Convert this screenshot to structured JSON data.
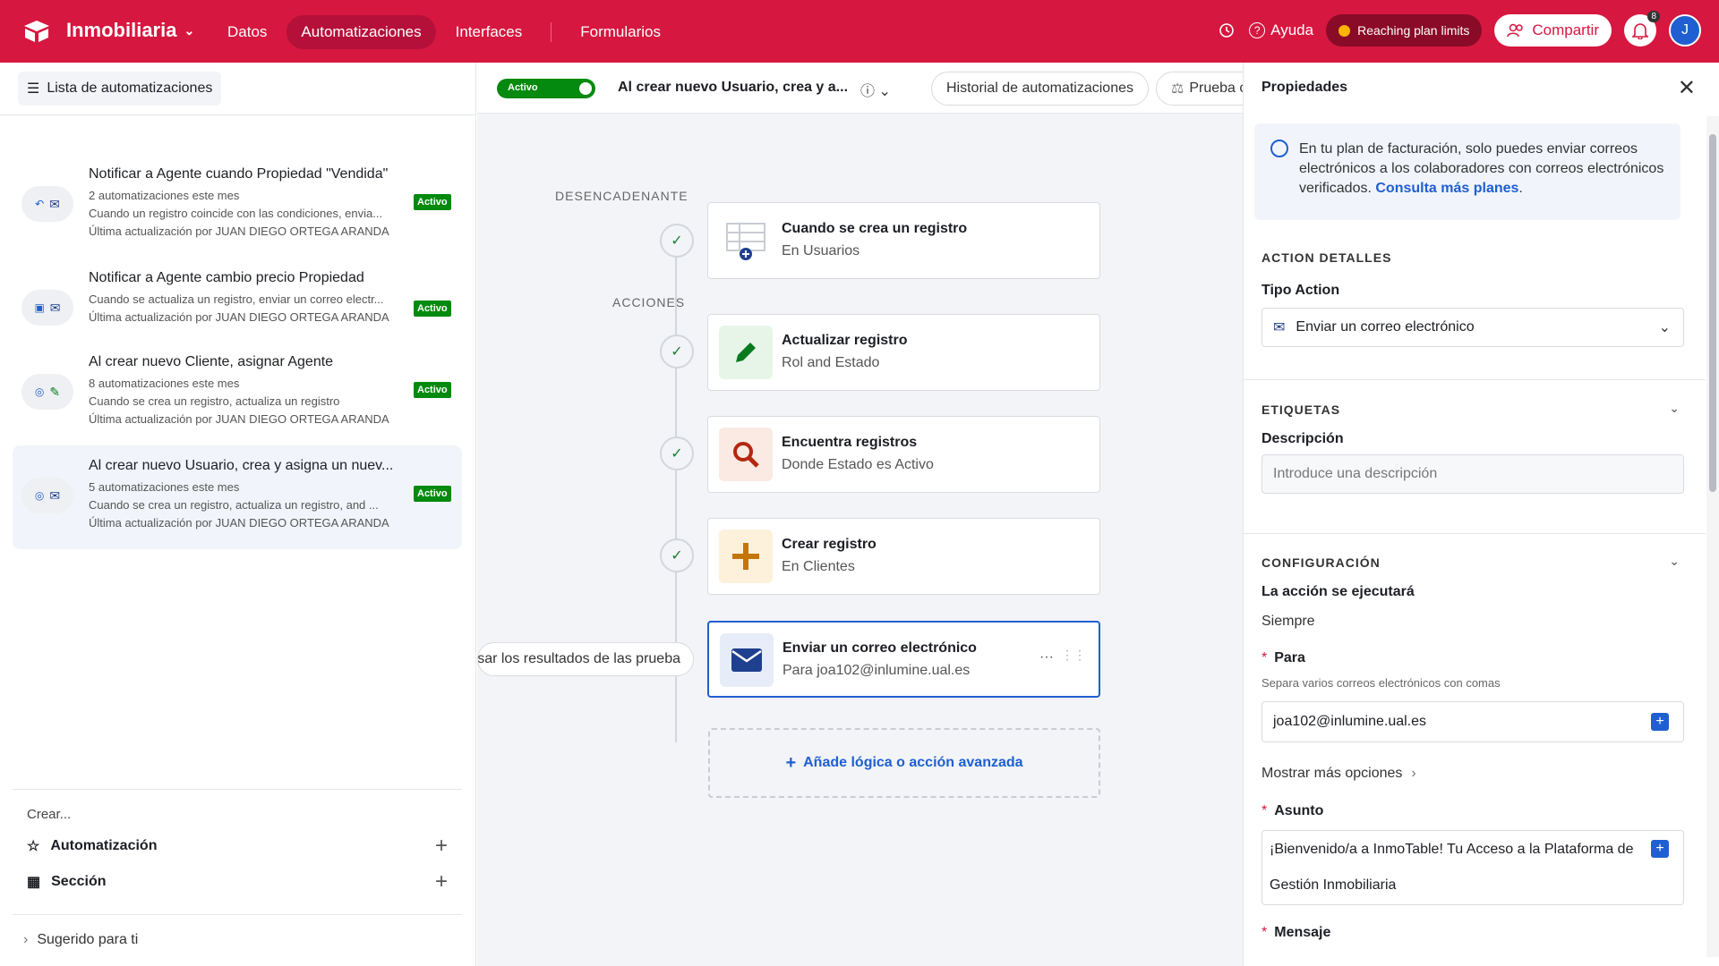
{
  "topbar": {
    "app_name": "Inmobiliaria",
    "tabs": [
      {
        "label": "Datos"
      },
      {
        "label": "Automatizaciones"
      },
      {
        "label": "Interfaces"
      },
      {
        "label": "Formularios"
      }
    ],
    "help_label": "Ayuda",
    "plan_label": "Reaching plan limits",
    "share_label": "Compartir",
    "notification_count": "8",
    "avatar_initial": "J"
  },
  "left": {
    "list_button": "Lista de automatizaciones",
    "automations": [
      {
        "title": "Notificar a Agente cuando Propiedad \"Vendida\"",
        "count": "2 automatizaciones este mes",
        "desc": "Cuando un registro coincide con las condiciones, envia...",
        "updated": "Última actualización por JUAN DIEGO ORTEGA ARANDA",
        "status": "Activo"
      },
      {
        "title": "Notificar a Agente cambio precio Propiedad",
        "count": "",
        "desc": "Cuando se actualiza un registro, enviar un correo electr...",
        "updated": "Última actualización por JUAN DIEGO ORTEGA ARANDA",
        "status": "Activo"
      },
      {
        "title": "Al crear nuevo Cliente, asignar Agente",
        "count": "8 automatizaciones este mes",
        "desc": "Cuando se crea un registro, actualiza un registro",
        "updated": "Última actualización por JUAN DIEGO ORTEGA ARANDA",
        "status": "Activo"
      },
      {
        "title": "Al crear nuevo Usuario, crea y asigna un nuev...",
        "count": "5 automatizaciones este mes",
        "desc": "Cuando se crea un registro, actualiza un registro, and ...",
        "updated": "Última actualización por JUAN DIEGO ORTEGA ARANDA",
        "status": "Activo"
      }
    ],
    "create_label": "Crear...",
    "create_automation": "Automatización",
    "create_section": "Sección",
    "suggested": "Sugerido para ti"
  },
  "canvas": {
    "toggle_label": "Activo",
    "title": "Al crear nuevo Usuario, crea y a...",
    "history_btn": "Historial de automatizaciones",
    "test_btn": "Prueba c",
    "trigger_label": "DESENCADENANTE",
    "actions_label": "ACCIONES",
    "cards": [
      {
        "title": "Cuando se crea un registro",
        "sub": "En Usuarios"
      },
      {
        "title": "Actualizar registro",
        "sub": "Rol and Estado"
      },
      {
        "title": "Encuentra registros",
        "sub": "Donde Estado es Activo"
      },
      {
        "title": "Crear registro",
        "sub": "En Clientes"
      },
      {
        "title": "Enviar un correo electrónico",
        "sub": "Para joa102@inlumine.ual.es"
      }
    ],
    "results_btn": "sar los resultados de las prueba",
    "add_logic": "Añade lógica o acción avanzada",
    "more_glyph": "···",
    "drag_glyph": "⋮⋮"
  },
  "right": {
    "title": "Propiedades",
    "notice_text": "En tu plan de facturación, solo puedes enviar correos electrónicos a los colaboradores con correos electrónicos verificados.",
    "notice_link": "Consulta más planes",
    "action_details": "ACTION DETALLES",
    "action_type_label": "Tipo Action",
    "action_type_value": "Enviar un correo electrónico",
    "labels_section": "ETIQUETAS",
    "description_label": "Descripción",
    "description_placeholder": "Introduce una descripción",
    "config_section": "CONFIGURACIÓN",
    "run_label": "La acción se ejecutará",
    "run_value": "Siempre",
    "to_label": "Para",
    "to_hint": "Separa varios correos electrónicos con comas",
    "to_value": "joa102@inlumine.ual.es",
    "more_options": "Mostrar más opciones",
    "subject_label": "Asunto",
    "subject_line1": "¡Bienvenido/a a InmoTable! Tu Acceso a la Plataforma de",
    "subject_line2": "Gestión Inmobiliaria",
    "message_label": "Mensaje"
  },
  "colors": {
    "brand": "#d6173f",
    "active_green": "#048a0e",
    "link_blue": "#1f5fd1"
  }
}
